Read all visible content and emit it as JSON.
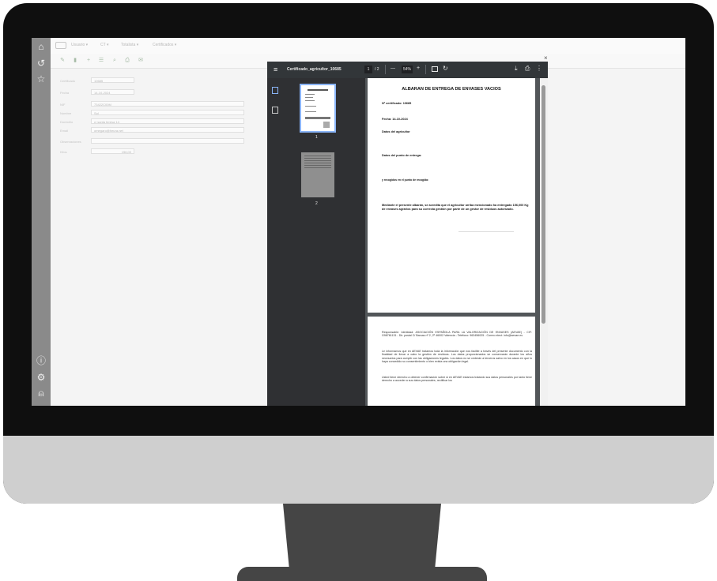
{
  "app": {
    "menu": [
      "Usuario ▾",
      "CT ▾",
      "Totalista ▾",
      "Certificados ▾"
    ],
    "form": [
      {
        "label": "Certificado",
        "value": "10685"
      },
      {
        "label": "Fecha",
        "value": "14-10-2024"
      },
      {
        "label": "NIF",
        "value": "73422C00M"
      },
      {
        "label": "Nombre",
        "value": "Sol"
      },
      {
        "label": "Domicilio",
        "value": "c/ santa teresa 14"
      },
      {
        "label": "Email",
        "value": "omegaro@heura.net"
      },
      {
        "label": "Observaciones",
        "value": ""
      },
      {
        "label": "Kilos",
        "value": "156,00"
      }
    ]
  },
  "pdf": {
    "close": "×",
    "filename": "Certificado_agricultor_10685",
    "page_current": "1",
    "page_total": "/ 2",
    "zoom": "54%",
    "minus": "—",
    "plus": "+",
    "thumb_labels": [
      "1",
      "2"
    ],
    "doc": {
      "title": "ALBARAN DE ENTREGA DE ENVASES VACIOS",
      "certificate": "Nº certificado: 10685",
      "date": "Fecha: 14-10-2024",
      "farmer_section": "Datos del agricultor",
      "delivery_section": "Datos del punto de entrega:",
      "pickup_note": "y recogidos en el punto de recogida:",
      "statement": "Mediante el presente albarán, se acredita que el agricultor arriba mencionado ha entregado 156,000 Kg de envases agrarios para su correcta gestión por parte de un gestor de residuos autorizado.",
      "page2_p1": "Responsable: Identidad: ASOCIACIÓN ESPAÑOLA PARA LA VALORIZACIÓN DE ENVASES (AEVAE) - CIF: G98761131 - Dir. postal C/ Barcas nº 2, 2º 46002 Valencia - Teléfono: 963456025 - Correo elect: info@aevae.es",
      "page2_p2": "Le informamos que en AEVAE tratamos toda la información que nos facilite a través del presente documento con la finalidad de llevar a cabo la gestión de residuos. Los datos proporcionados se conservarán durante los años necesarios para cumplir con las obligaciones legales. Los datos no se cederán a terceros salvo en los casos en que lo haya concedido su consentimiento o bien exista una obligación legal.",
      "page2_p3": "Usted tiene derecho a obtener confirmación sobre si en AEVAE estamos tratando sus datos personales por tanto tiene derecho a acceder a sus datos personales, rectificar los"
    }
  },
  "colors": {
    "app_sidebar": "#8a8a8a",
    "pdf_toolbar": "#323639",
    "accent": "#8ab4f8"
  }
}
